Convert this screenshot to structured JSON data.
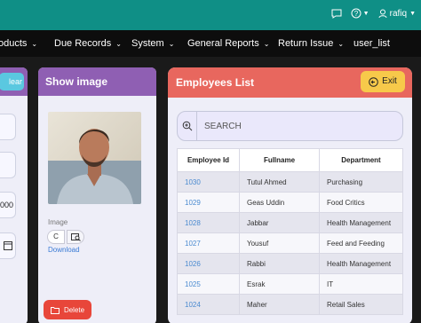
{
  "topbar": {
    "icons": [
      "chat-icon",
      "help-icon",
      "user-icon"
    ],
    "username": "rafiq"
  },
  "nav": {
    "items": [
      {
        "label": "oducts"
      },
      {
        "label": "Due Records"
      },
      {
        "label": "System"
      },
      {
        "label": "General Reports"
      },
      {
        "label": "Return Issue"
      },
      {
        "label": "user_list"
      }
    ]
  },
  "left_panel": {
    "clear_label": "lear",
    "partial_value": "000"
  },
  "image_panel": {
    "title": "Show image",
    "image_label": "Image",
    "file_button_text": "C",
    "download_label": "Download",
    "delete_label": "Delete"
  },
  "employees": {
    "title": "Employees List",
    "exit_label": "Exit",
    "search_placeholder": "SEARCH",
    "columns": [
      "Employee Id",
      "Fullname",
      "Department"
    ],
    "rows": [
      {
        "id": "1030",
        "name": "Tutul Ahmed",
        "dept": "Purchasing"
      },
      {
        "id": "1029",
        "name": "Geas Uddin",
        "dept": "Food Critics"
      },
      {
        "id": "1028",
        "name": "Jabbar",
        "dept": "Health Management"
      },
      {
        "id": "1027",
        "name": "Yousuf",
        "dept": "Feed and Feeding"
      },
      {
        "id": "1026",
        "name": "Rabbi",
        "dept": "Health Management"
      },
      {
        "id": "1025",
        "name": "Esrak",
        "dept": "IT"
      },
      {
        "id": "1024",
        "name": "Maher",
        "dept": "Retail Sales"
      }
    ]
  },
  "colors": {
    "topbar": "#0f8f86",
    "nav": "#0d0d0d",
    "purple_header": "#8f5fb3",
    "red_header": "#e8675e",
    "exit_button": "#f7c94a",
    "delete_button": "#e8463a",
    "link": "#3a7bd5"
  }
}
